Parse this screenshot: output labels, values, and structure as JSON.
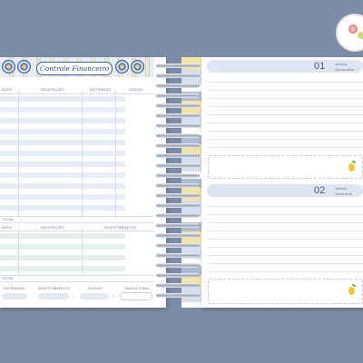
{
  "left_page": {
    "title": "Controle Financeiro",
    "table1_headers": [
      "DATA",
      "DESCRIÇÃO",
      "ENTRADAS",
      "SAÍDAS"
    ],
    "table1_total": "TOTAL",
    "table2_headers": [
      "DATA",
      "DESCRIÇÃO",
      "INVESTIMENTOS"
    ],
    "table2_total": "TOTAL",
    "footer_labels": [
      "ENTRADAS",
      "INVESTIMENTOS",
      "SAÍDAS",
      "SALDO FINAL"
    ]
  },
  "right_page": {
    "days": [
      {
        "number": "01",
        "month": "Janeiro",
        "weekday": "Quinta-feira"
      },
      {
        "number": "02",
        "month": "Janeiro",
        "weekday": "Sexta-feira"
      }
    ]
  },
  "colors": {
    "background": "#7a8ca6",
    "azulejo_blue": "#3d5d93",
    "lemon_yellow": "#f1c736"
  }
}
